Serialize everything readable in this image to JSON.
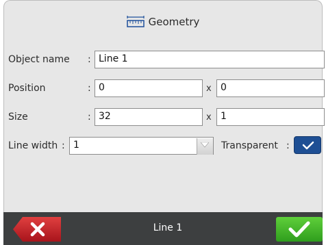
{
  "tab": {
    "title": "Geometry",
    "icon": "ruler-icon"
  },
  "fields": {
    "object_name": {
      "label": "Object name",
      "value": "Line 1"
    },
    "position": {
      "label": "Position",
      "x_value": "0",
      "y_value": "0",
      "separator": "x"
    },
    "size": {
      "label": "Size",
      "width_value": "32",
      "height_value": "1",
      "separator": "x"
    },
    "line_width": {
      "label": "Line width",
      "value": "1"
    },
    "transparent": {
      "label": "Transparent",
      "checked": true
    }
  },
  "colon": ":",
  "bottom_bar": {
    "title": "Line 1",
    "cancel_icon": "close-icon",
    "confirm_icon": "checkmark-icon"
  },
  "colors": {
    "cancel": "#c8202a",
    "confirm": "#3fb52a",
    "checkbox": "#1e4f94",
    "bar": "#3d3f40"
  }
}
